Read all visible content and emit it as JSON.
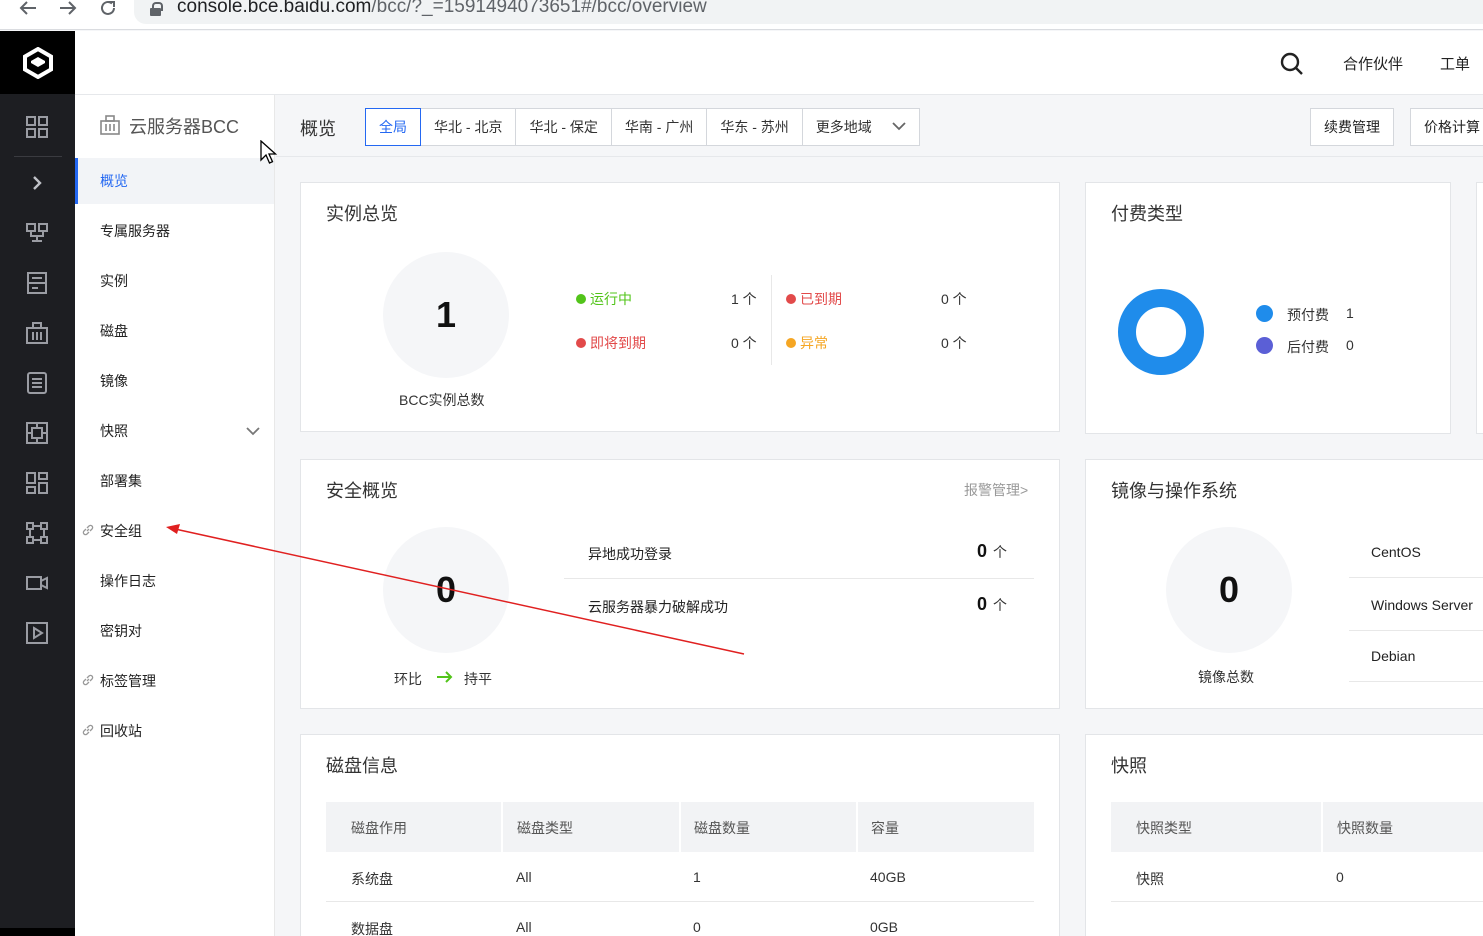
{
  "browser": {
    "url_host": "console.bce.baidu.com",
    "url_path": "/bcc/?_=1591494073651#/bcc/overview"
  },
  "header": {
    "partner_label": "合作伙伴",
    "ticket_label": "工单"
  },
  "sidebar": {
    "title": "云服务器BCC",
    "items": [
      {
        "label": "概览",
        "active": true
      },
      {
        "label": "专属服务器"
      },
      {
        "label": "实例"
      },
      {
        "label": "磁盘"
      },
      {
        "label": "镜像"
      },
      {
        "label": "快照",
        "expandable": true
      },
      {
        "label": "部署集"
      },
      {
        "label": "安全组",
        "external_link": true
      },
      {
        "label": "操作日志"
      },
      {
        "label": "密钥对"
      },
      {
        "label": "标签管理",
        "external_link": true
      },
      {
        "label": "回收站",
        "external_link": true
      }
    ]
  },
  "toolbar": {
    "title": "概览",
    "regions": [
      "全局",
      "华北 - 北京",
      "华北 - 保定",
      "华南 - 广州",
      "华东 - 苏州",
      "更多地域"
    ],
    "active_region": "全局",
    "renew_button": "续费管理",
    "price_button": "价格计算"
  },
  "instance_overview": {
    "title": "实例总览",
    "total": "1",
    "total_caption": "BCC实例总数",
    "stats": [
      {
        "label": "运行中",
        "value": "1 个",
        "color": "#52c41a"
      },
      {
        "label": "已到期",
        "value": "0 个",
        "color": "#e24a4a"
      },
      {
        "label": "即将到期",
        "value": "0 个",
        "color": "#e24a4a"
      },
      {
        "label": "异常",
        "value": "0 个",
        "color": "#f5a623"
      }
    ]
  },
  "payment_type": {
    "title": "付费类型",
    "legend": [
      {
        "label": "预付费",
        "value": "1",
        "color": "#1f8ceb"
      },
      {
        "label": "后付费",
        "value": "0",
        "color": "#5b5fd6"
      }
    ]
  },
  "security_overview": {
    "title": "安全概览",
    "alarm_link": "报警管理>",
    "total": "0",
    "compare_label": "环比",
    "compare_value": "持平",
    "rows": [
      {
        "label": "异地成功登录",
        "value": "0",
        "unit": "个"
      },
      {
        "label": "云服务器暴力破解成功",
        "value": "0",
        "unit": "个"
      }
    ]
  },
  "images_os": {
    "title": "镜像与操作系统",
    "total": "0",
    "total_caption": "镜像总数",
    "os_list": [
      "CentOS",
      "Windows Server",
      "Debian"
    ]
  },
  "disk_info": {
    "title": "磁盘信息",
    "headers": [
      "磁盘作用",
      "磁盘类型",
      "磁盘数量",
      "容量"
    ],
    "rows": [
      [
        "系统盘",
        "All",
        "1",
        "40GB"
      ],
      [
        "数据盘",
        "All",
        "0",
        "0GB"
      ]
    ]
  },
  "snapshot": {
    "title": "快照",
    "headers": [
      "快照类型",
      "快照数量"
    ],
    "rows": [
      [
        "快照",
        "0"
      ]
    ]
  }
}
